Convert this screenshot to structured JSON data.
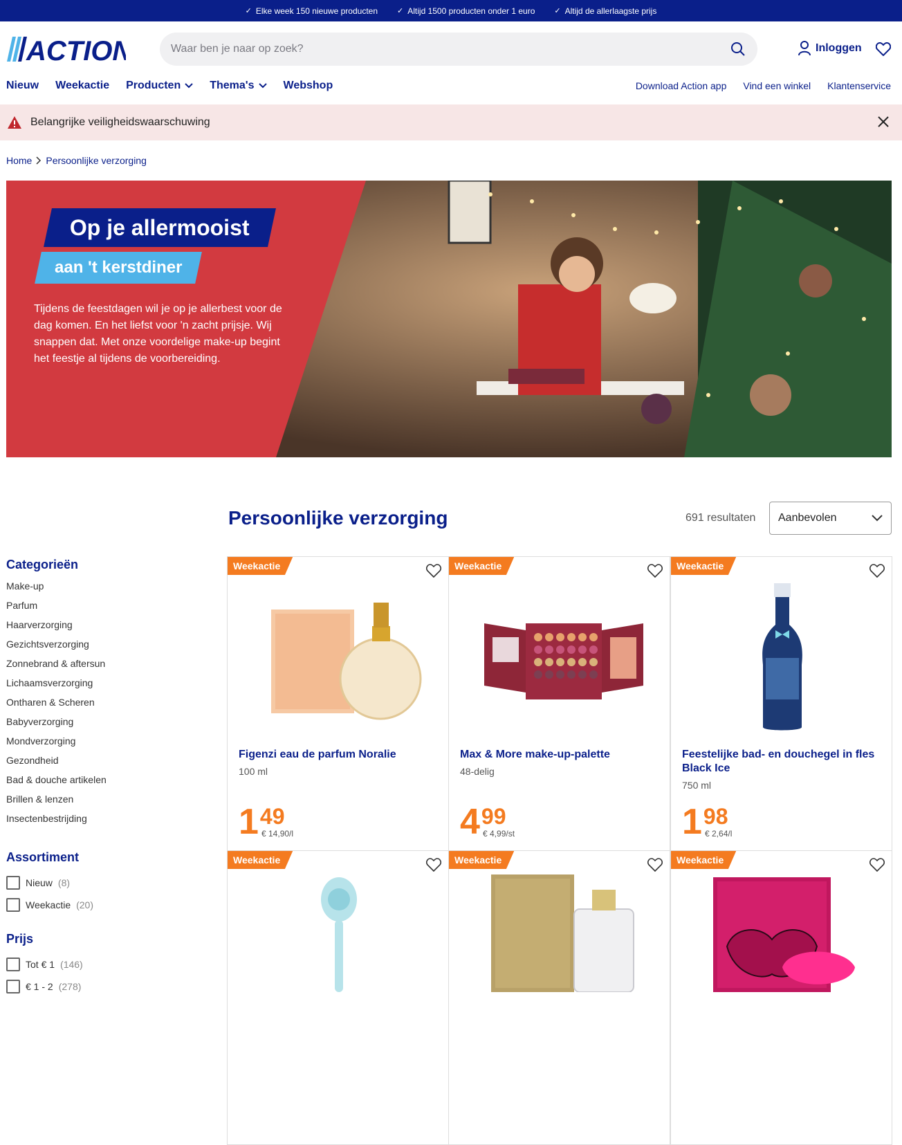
{
  "topbar": {
    "usps": [
      "Elke week 150 nieuwe producten",
      "Altijd 1500 producten onder 1 euro",
      "Altijd de allerlaagste prijs"
    ]
  },
  "header": {
    "logo_text": "ACTION",
    "search_placeholder": "Waar ben je naar op zoek?",
    "login_label": "Inloggen"
  },
  "nav": {
    "main": [
      "Nieuw",
      "Weekactie",
      "Producten",
      "Thema's",
      "Webshop"
    ],
    "right": [
      "Download Action app",
      "Vind een winkel",
      "Klantenservice"
    ]
  },
  "alert": {
    "text": "Belangrijke veiligheidswaarschuwing"
  },
  "breadcrumb": {
    "home": "Home",
    "current": "Persoonlijke verzorging"
  },
  "hero": {
    "title": "Op je allermooist",
    "subtitle": "aan 't kerstdiner",
    "description": "Tijdens de feestdagen wil je op je allerbest voor de dag komen. En het liefst voor 'n zacht prijsje. Wij snappen dat. Met onze voordelige make-up begint het feestje al tijdens de voorbereiding."
  },
  "listing": {
    "title": "Persoonlijke verzorging",
    "results": "691 resultaten",
    "sort_value": "Aanbevolen"
  },
  "sidebar": {
    "categories_title": "Categorieën",
    "categories": [
      "Make-up",
      "Parfum",
      "Haarverzorging",
      "Gezichtsverzorging",
      "Zonnebrand & aftersun",
      "Lichaamsverzorging",
      "Ontharen & Scheren",
      "Babyverzorging",
      "Mondverzorging",
      "Gezondheid",
      "Bad & douche artikelen",
      "Brillen & lenzen",
      "Insectenbestrijding"
    ],
    "assortment_title": "Assortiment",
    "assortment": [
      {
        "label": "Nieuw",
        "count": "(8)"
      },
      {
        "label": "Weekactie",
        "count": "(20)"
      }
    ],
    "price_title": "Prijs",
    "price": [
      {
        "label": "Tot € 1",
        "count": "(146)"
      },
      {
        "label": "€ 1 - 2",
        "count": "(278)"
      }
    ]
  },
  "products": [
    {
      "badge": "Weekactie",
      "name": "Figenzi eau de parfum Noralie",
      "sub": "100 ml",
      "euro": "1",
      "cents": "49",
      "unit": "€ 14,90/l",
      "image": "perfume-noralie"
    },
    {
      "badge": "Weekactie",
      "name": "Max & More make-up-palette",
      "sub": "48-delig",
      "euro": "4",
      "cents": "99",
      "unit": "€ 4,99/st",
      "image": "makeup-palette"
    },
    {
      "badge": "Weekactie",
      "name": "Feestelijke bad- en douchegel in fles Black Ice",
      "sub": "750 ml",
      "euro": "1",
      "cents": "98",
      "unit": "€ 2,64/l",
      "image": "shower-gel-bottle"
    },
    {
      "badge": "Weekactie",
      "name": "",
      "sub": "",
      "euro": "",
      "cents": "",
      "unit": "",
      "image": "face-brush"
    },
    {
      "badge": "Weekactie",
      "name": "",
      "sub": "",
      "euro": "",
      "cents": "",
      "unit": "",
      "image": "perfume-ma-richesse"
    },
    {
      "badge": "Weekactie",
      "name": "",
      "sub": "",
      "euro": "",
      "cents": "",
      "unit": "",
      "image": "perfume-blush-lips"
    }
  ],
  "colors": {
    "brand_blue": "#0a1f8a",
    "accent_orange": "#f47b20",
    "light_blue": "#4fb3e8",
    "hero_red": "#d23a40"
  }
}
